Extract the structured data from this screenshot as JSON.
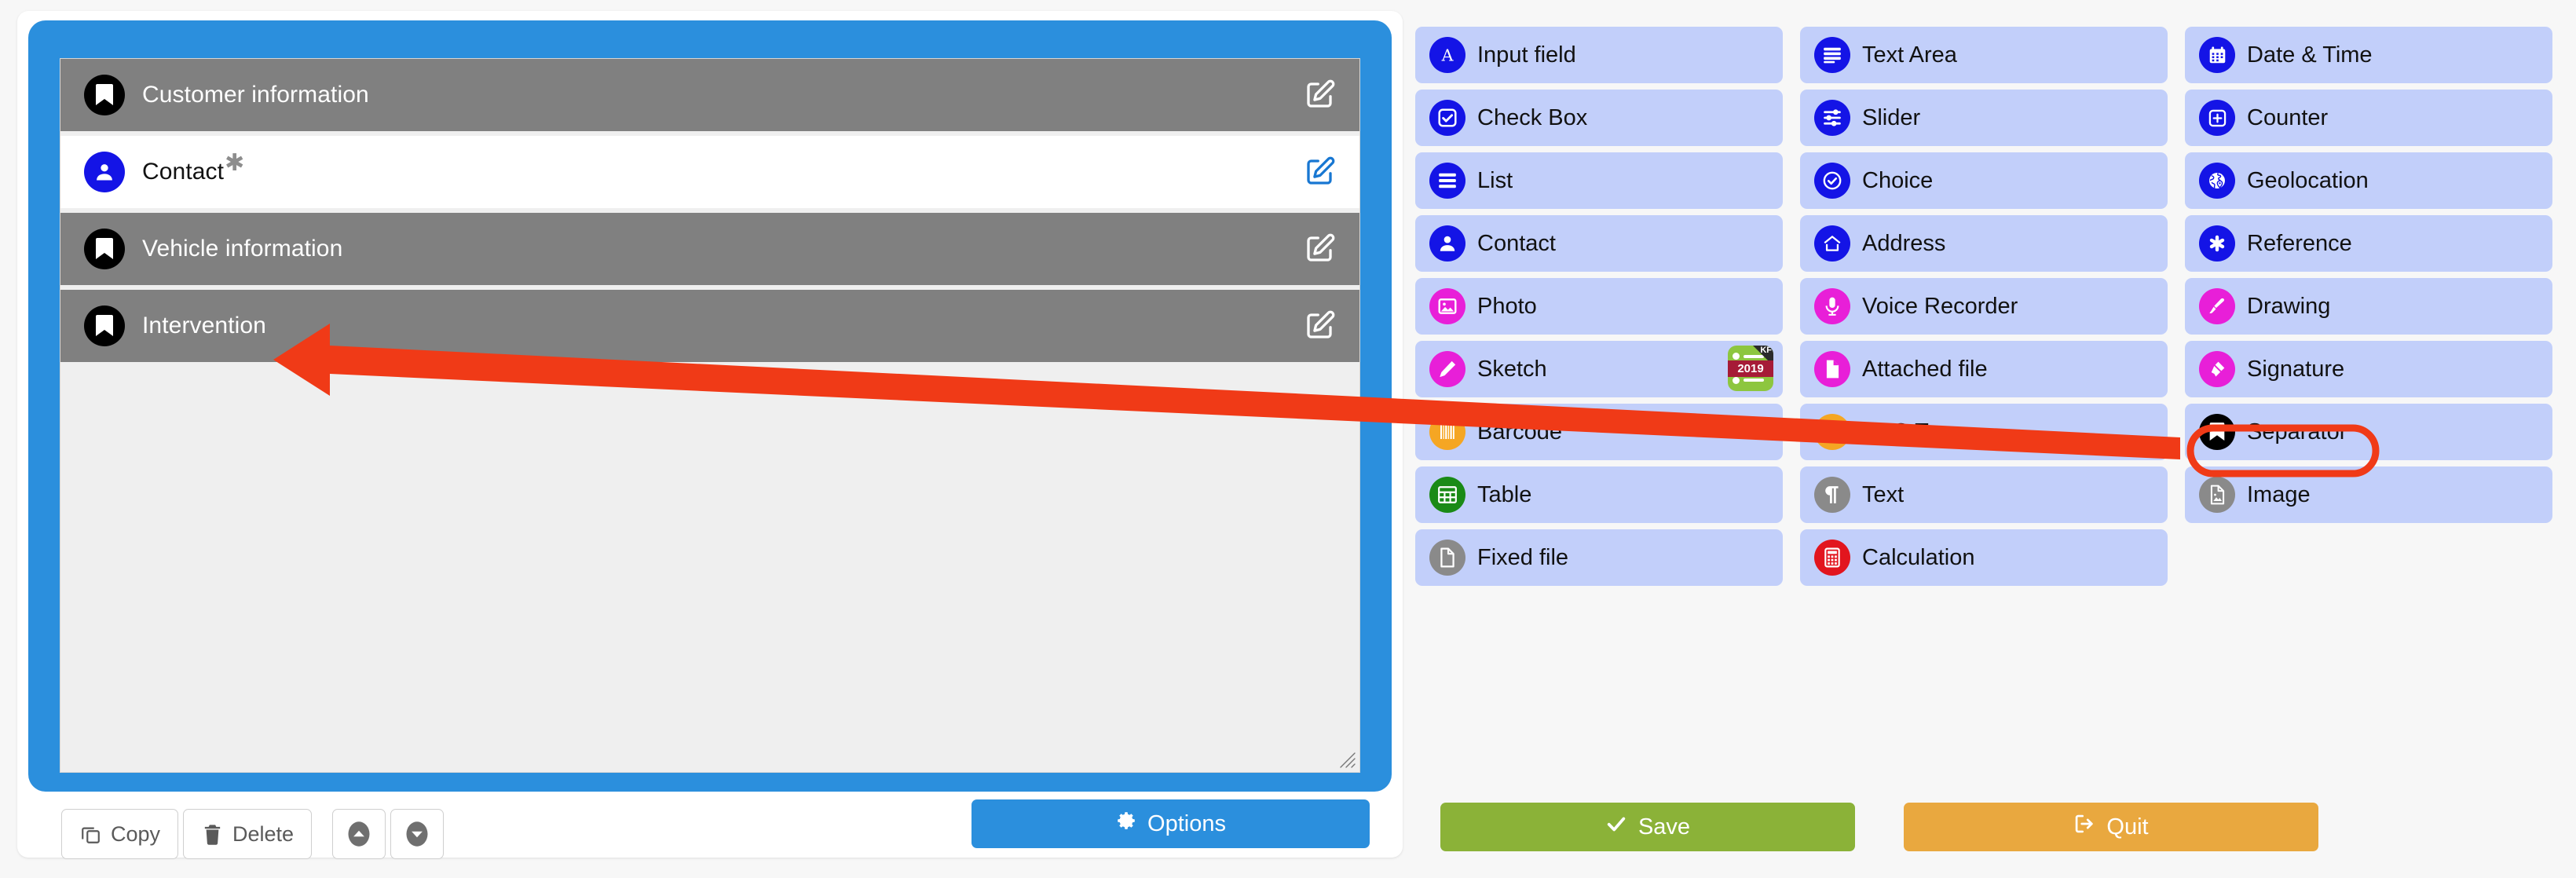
{
  "accent": {
    "panel_blue": "#2b8fdd",
    "palette_item_bg": "#c2cffa",
    "separator_row_gray": "#808080",
    "annotation_red": "#f03a17",
    "icon_blue": "#1414e6",
    "icon_magenta": "#e81fd8",
    "icon_orange": "#f5a623",
    "icon_green": "#1a8a16",
    "icon_gray": "#8a8a8a",
    "icon_red": "#e2151e",
    "save_green": "#8bb238",
    "quit_orange": "#e9a83f"
  },
  "form": {
    "rows": [
      {
        "label": "Customer information",
        "type": "separator",
        "icon": "bookmark-icon",
        "icon_color": "black",
        "edit_icon": "edit-square-icon",
        "edit_color": "white",
        "required": false
      },
      {
        "label": "Contact",
        "type": "field",
        "icon": "contact-person-icon",
        "icon_color": "blue",
        "edit_icon": "edit-square-icon",
        "edit_color": "blue",
        "required": true,
        "required_marker": "✱"
      },
      {
        "label": "Vehicle information",
        "type": "separator",
        "icon": "bookmark-icon",
        "icon_color": "black",
        "edit_icon": "edit-square-icon",
        "edit_color": "white",
        "required": false
      },
      {
        "label": "Intervention",
        "type": "separator",
        "icon": "bookmark-icon",
        "icon_color": "black",
        "edit_icon": "edit-square-icon",
        "edit_color": "white",
        "required": false
      }
    ],
    "resize_handle": "resize-grip-icon"
  },
  "toolbar": {
    "copy_label": "Copy",
    "copy_icon": "copy-icon",
    "delete_label": "Delete",
    "delete_icon": "trash-icon",
    "move_up_icon": "chevron-up-circle-icon",
    "move_down_icon": "chevron-down-circle-icon",
    "options_label": "Options",
    "options_icon": "gear-icon"
  },
  "actions": {
    "save_label": "Save",
    "save_icon": "check-icon",
    "quit_label": "Quit",
    "quit_icon": "exit-icon"
  },
  "palette": {
    "columns": [
      {
        "items": [
          {
            "label": "Input field",
            "icon": "letter-a-icon",
            "color": "c-blue"
          },
          {
            "label": "Check Box",
            "icon": "checkbox-icon",
            "color": "c-blue"
          },
          {
            "label": "List",
            "icon": "list-lines-icon",
            "color": "c-blue"
          },
          {
            "label": "Contact",
            "icon": "contact-person-icon",
            "color": "c-blue"
          },
          {
            "label": "Photo",
            "icon": "photo-icon",
            "color": "c-magenta"
          },
          {
            "label": "Sketch",
            "icon": "pencil-icon",
            "color": "c-magenta",
            "badge": {
              "corner_text": "KF",
              "year_text": "2019"
            }
          },
          {
            "label": "Barcode",
            "icon": "barcode-icon",
            "color": "c-orange"
          },
          {
            "label": "Table",
            "icon": "table-grid-icon",
            "color": "c-green"
          },
          {
            "label": "Fixed file",
            "icon": "file-icon",
            "color": "c-gray"
          }
        ]
      },
      {
        "items": [
          {
            "label": "Text Area",
            "icon": "text-lines-icon",
            "color": "c-blue"
          },
          {
            "label": "Slider",
            "icon": "sliders-icon",
            "color": "c-blue"
          },
          {
            "label": "Choice",
            "icon": "check-circle-icon",
            "color": "c-blue"
          },
          {
            "label": "Address",
            "icon": "home-icon",
            "color": "c-blue"
          },
          {
            "label": "Voice Recorder",
            "icon": "microphone-icon",
            "color": "c-magenta"
          },
          {
            "label": "Attached file",
            "icon": "file-icon",
            "color": "c-magenta"
          },
          {
            "label": "NFC Tag",
            "icon": "nfc-signal-icon",
            "color": "c-orange"
          },
          {
            "label": "Text",
            "icon": "pilcrow-icon",
            "color": "c-gray"
          },
          {
            "label": "Calculation",
            "icon": "calculator-icon",
            "color": "c-red"
          }
        ]
      },
      {
        "items": [
          {
            "label": "Date & Time",
            "icon": "calendar-icon",
            "color": "c-blue"
          },
          {
            "label": "Counter",
            "icon": "plus-square-icon",
            "color": "c-blue"
          },
          {
            "label": "Geolocation",
            "icon": "globe-pin-icon",
            "color": "c-blue"
          },
          {
            "label": "Reference",
            "icon": "asterisk-icon",
            "color": "c-blue"
          },
          {
            "label": "Drawing",
            "icon": "paintbrush-icon",
            "color": "c-magenta"
          },
          {
            "label": "Signature",
            "icon": "signature-pen-icon",
            "color": "c-magenta"
          },
          {
            "label": "Separator",
            "icon": "bookmark-icon",
            "color": "c-black",
            "highlighted": true
          },
          {
            "label": "Image",
            "icon": "image-file-icon",
            "color": "c-gray"
          }
        ]
      }
    ]
  },
  "annotation": {
    "arrow_icon": "red-arrow-left",
    "arrow_description": "Red arrow pointing from the Separator palette item to the Intervention form row",
    "highlight_icon": "red-ellipse-highlight",
    "highlight_target": "Separator"
  }
}
